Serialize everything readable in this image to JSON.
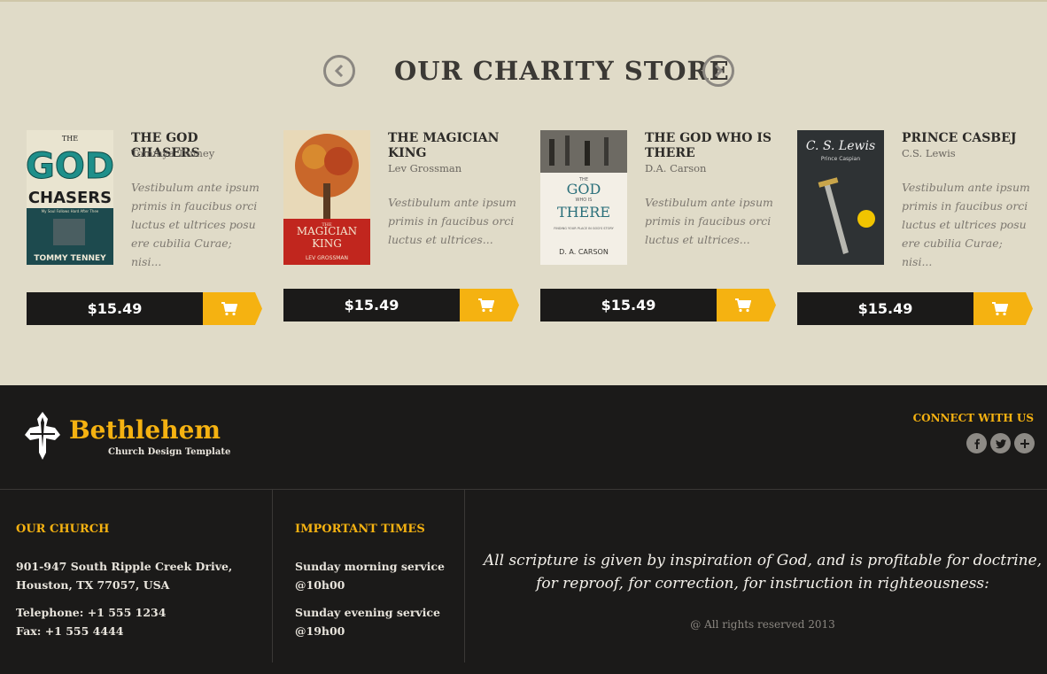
{
  "store": {
    "title": "OUR CHARITY STORE",
    "prev_icon": "chevron-left-icon",
    "next_icon": "chevron-right-icon",
    "products": [
      {
        "title": "THE GOD CHASERS",
        "author": "Tommya Tenney",
        "description": "Vestibulum ante ipsum primis in faucibus orci luctus et ultrices posu ere cubilia Curae; nisi...",
        "price": "$15.49",
        "cover": {
          "line1": "THE",
          "line2": "GOD",
          "line3": "CHASERS",
          "subtitle": "My Soul Follows Hard After Thee",
          "author": "TOMMY TENNEY"
        }
      },
      {
        "title": "THE MAGICIAN KING",
        "author": "Lev Grossman",
        "description": "Vestibulum ante ipsum primis in faucibus orci luctus et ultrices...",
        "price": "$15.49",
        "cover": {
          "line1": "THE",
          "line2": "MAGICIAN",
          "line3": "KING",
          "author": "LEV GROSSMAN"
        }
      },
      {
        "title": "THE GOD WHO IS THERE",
        "author": "D.A. Carson",
        "description": "Vestibulum ante ipsum primis in faucibus orci luctus et ultrices...",
        "price": "$15.49",
        "cover": {
          "line1": "THE",
          "line2": "GOD",
          "line3": "WHO IS",
          "line4": "THERE",
          "subtitle": "FINDING YOUR PLACE IN GOD'S STORY",
          "author": "D. A. CARSON"
        }
      },
      {
        "title": "PRINCE CASBEJ",
        "author": "C.S. Lewis",
        "description": "Vestibulum ante ipsum primis in faucibus orci luctus et ultrices posu ere cubilia Curae; nisi...",
        "price": "$15.49",
        "cover": {
          "author": "C. S. Lewis",
          "line1": "Prince Caspian"
        }
      }
    ],
    "cart_icon": "shopping-cart-icon"
  },
  "footer": {
    "logo_name": "Bethlehem",
    "logo_tag": "Church Design Template",
    "connect": "CONNECT WITH US",
    "socials": [
      "facebook-icon",
      "twitter-icon",
      "plus-icon"
    ],
    "church": {
      "heading": "OUR CHURCH",
      "address1": "901-947 South Ripple Creek Drive,",
      "address2": "Houston, TX 77057, USA",
      "telephone": "Telephone: +1 555 1234",
      "fax": "Fax: +1 555 4444"
    },
    "times": {
      "heading": "IMPORTANT TIMES",
      "morning": "Sunday morning service",
      "morning_time": "@10h00",
      "evening": "Sunday evening service",
      "evening_time": "@19h00"
    },
    "quote_line1": "All scripture is given by inspiration of God, and is profitable for doctrine,",
    "quote_line2": "for reproof, for correction, for instruction in righteousness:",
    "copyright": "@ All rights reserved 2013"
  },
  "colors": {
    "accent": "#f5b211",
    "dark": "#1b1a19",
    "store_bg": "#e0dbc8"
  }
}
